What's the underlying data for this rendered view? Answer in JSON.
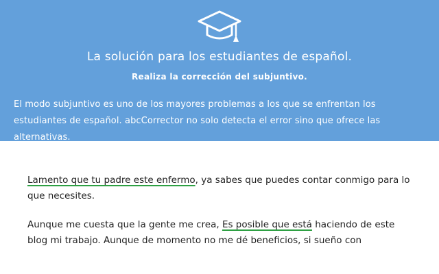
{
  "hero": {
    "icon": "graduation-cap-icon",
    "title": "La solución para los estudiantes de español.",
    "subtitle": "Realiza la corrección del subjuntivo.",
    "description": "El modo subjuntivo es uno de los mayores problemas a los que se enfrentan los estudiantes de español. abcCorrector no solo detecta el error sino que ofrece las alternativas.",
    "background": "#63a0db"
  },
  "document": {
    "p1_error": "Lamento que tu padre este enfermo",
    "p1_rest": ", ya sabes que puedes contar conmigo para lo que necesites.",
    "p2_before": "Aunque me cuesta que la gente me crea, ",
    "p2_error": "Es posible que está",
    "p2_after": " haciendo de este blog  mi trabajo. Aunque de momento no me dé beneficios, si sueño con",
    "underline_color": "#2ea043"
  }
}
